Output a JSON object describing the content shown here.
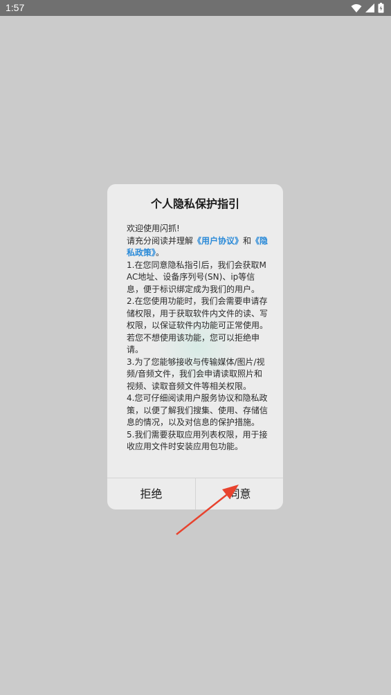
{
  "status_bar": {
    "time": "1:57",
    "icons": [
      "wifi-icon",
      "signal-icon",
      "battery-icon"
    ]
  },
  "dialog": {
    "title": "个人隐私保护指引",
    "welcome": "欢迎使用闪抓!",
    "intro_prefix": "请充分阅读并理解",
    "user_agreement_link": "《用户协议》",
    "intro_and": "和",
    "privacy_policy_link": "《隐私政策》",
    "intro_suffix": "。",
    "items": [
      "1.在您同意隐私指引后，我们会获取MAC地址、设备序列号(SN)、ip等信息，便于标识绑定成为我们的用户。",
      "2.在您使用功能时，我们会需要申请存储权限，用于获取软件内文件的读、写权限，以保证软件内功能可正常使用。若您不想使用该功能，您可以拒绝申请。",
      "3.为了您能够接收与传输媒体/图片/视频/音频文件，我们会申请读取照片和视频、读取音频文件等相关权限。",
      "4.您可仔细阅读用户服务协议和隐私政策，以便了解我们搜集、使用、存储信息的情况，以及对信息的保护措施。",
      "5.我们需要获取应用列表权限，用于接收应用文件时安装应用包功能。"
    ],
    "refuse_label": "拒绝",
    "agree_label": "同意"
  },
  "colors": {
    "link": "#2a8ad8",
    "annotation_arrow": "#e8432e",
    "background": "#cbcbcb",
    "dialog_bg": "#ececec"
  }
}
